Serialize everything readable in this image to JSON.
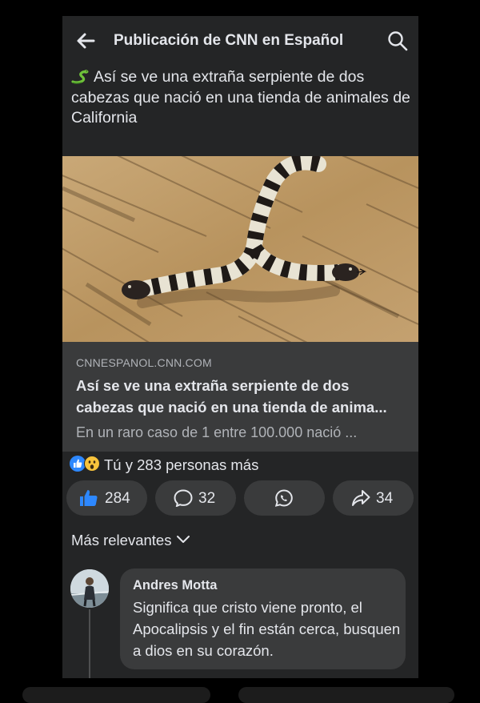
{
  "header": {
    "title": "Publicación de CNN en Español",
    "back_icon": "arrow-left-icon",
    "search_icon": "search-icon"
  },
  "post": {
    "text_icon": "snake-emoji",
    "text": "Así se ve una extraña serpiente de dos cabezas que nació en una tienda de animales de California"
  },
  "link_preview": {
    "domain": "CNNESPANOL.CNN.COM",
    "title_line1": "Así se ve una extraña serpiente de dos",
    "title_line2": "cabezas que nació en una tienda de anima...",
    "description": "En un raro caso de 1 entre 100.000 nació ..."
  },
  "reactions": {
    "icons": [
      "like-reaction-icon",
      "wow-reaction-icon"
    ],
    "summary": "Tú y 283 personas más"
  },
  "actions": {
    "like_count": "284",
    "comment_count": "32",
    "share_count": "34"
  },
  "comments": {
    "sort_label": "Más relevantes",
    "items": [
      {
        "author": "Andres Motta",
        "text": "Significa que cristo viene pronto, el Apocalipsis y el fin están cerca, busquen a dios en su corazón."
      }
    ]
  },
  "colors": {
    "background": "#242526",
    "card": "#3a3b3c",
    "text_primary": "#e4e6eb",
    "text_secondary": "#b0b3b8",
    "like_blue": "#2d88ff"
  }
}
